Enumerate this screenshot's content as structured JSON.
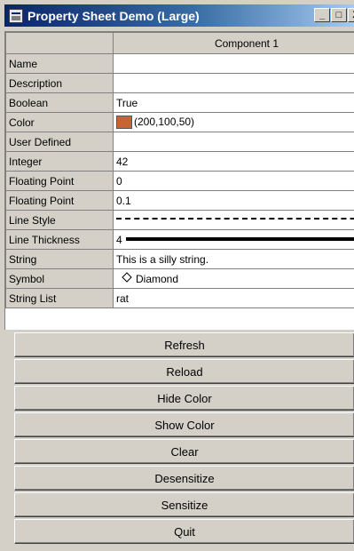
{
  "window": {
    "title": "Property Sheet Demo (Large)",
    "caption_buttons": [
      "_",
      "□",
      "X"
    ]
  },
  "sheet": {
    "column_header": "Component 1",
    "rows": [
      {
        "label": "Name",
        "value": ""
      },
      {
        "label": "Description",
        "value": ""
      },
      {
        "label": "Boolean",
        "value": "True"
      },
      {
        "label": "Color",
        "value": "(200,100,50)",
        "swatch": "#c86432"
      },
      {
        "label": "User Defined",
        "value": ""
      },
      {
        "label": "Integer",
        "value": "42"
      },
      {
        "label": "Floating Point",
        "value": "0"
      },
      {
        "label": "Floating Point",
        "value": "0.1"
      },
      {
        "label": "Line Style",
        "value": ""
      },
      {
        "label": "Line Thickness",
        "value": "4"
      },
      {
        "label": "String",
        "value": "This is a silly string."
      },
      {
        "label": "Symbol",
        "value": "Diamond",
        "icon": "diamond-icon"
      },
      {
        "label": "String List",
        "value": "rat"
      }
    ]
  },
  "buttons": {
    "refresh": "Refresh",
    "reload": "Reload",
    "hide_color": "Hide Color",
    "show_color": "Show Color",
    "clear": "Clear",
    "desensitize": "Desensitize",
    "sensitize": "Sensitize",
    "quit": "Quit"
  }
}
